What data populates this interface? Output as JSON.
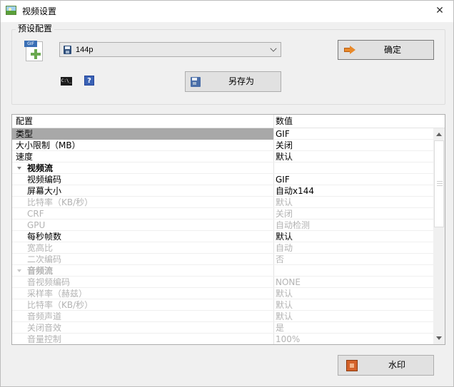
{
  "window": {
    "title": "视频设置",
    "close_glyph": "✕"
  },
  "preset": {
    "group_label": "预设配置",
    "selected": "144p",
    "confirm_label": "确定",
    "save_as_label": "另存为",
    "gif_tag": "GIF",
    "cmd_glyph": "C:\\_",
    "help_glyph": "?"
  },
  "grid": {
    "header": {
      "col_config": "配置",
      "col_value": "数值"
    },
    "rows": [
      {
        "key": "类型",
        "value": "GIF",
        "state": "selected"
      },
      {
        "key": "大小限制（MB）",
        "value": "关闭"
      },
      {
        "key": "速度",
        "value": "默认"
      },
      {
        "key": "视频流",
        "value": "",
        "section": true
      },
      {
        "key": "视频编码",
        "value": "GIF",
        "indent": true
      },
      {
        "key": "屏幕大小",
        "value": "自动x144",
        "indent": true
      },
      {
        "key": "比特率（KB/秒）",
        "value": "默认",
        "indent": true,
        "state": "disabled"
      },
      {
        "key": "CRF",
        "value": "关闭",
        "indent": true,
        "state": "disabled"
      },
      {
        "key": "GPU",
        "value": "自动检测",
        "indent": true,
        "state": "disabled"
      },
      {
        "key": "每秒帧数",
        "value": "默认",
        "indent": true
      },
      {
        "key": "宽高比",
        "value": "自动",
        "indent": true,
        "state": "disabled"
      },
      {
        "key": "二次编码",
        "value": "否",
        "indent": true,
        "state": "disabled"
      },
      {
        "key": "音频流",
        "value": "",
        "section": true,
        "state": "disabled"
      },
      {
        "key": "音视频编码",
        "value": "NONE",
        "indent": true,
        "state": "disabled"
      },
      {
        "key": "采样率（赫兹）",
        "value": "默认",
        "indent": true,
        "state": "disabled"
      },
      {
        "key": "比特率（KB/秒）",
        "value": "默认",
        "indent": true,
        "state": "disabled"
      },
      {
        "key": "音频声道",
        "value": "默认",
        "indent": true,
        "state": "disabled"
      },
      {
        "key": "关闭音效",
        "value": "是",
        "indent": true,
        "state": "disabled"
      },
      {
        "key": "音量控制",
        "value": "100%",
        "indent": true,
        "state": "disabled"
      }
    ]
  },
  "footer": {
    "watermark_label": "水印"
  },
  "colors": {
    "window_bg": "#f0f0f0",
    "selected_row": "#a8a8a8",
    "disabled_text": "#b3b3b3",
    "confirm_icon": "#e8892a"
  }
}
